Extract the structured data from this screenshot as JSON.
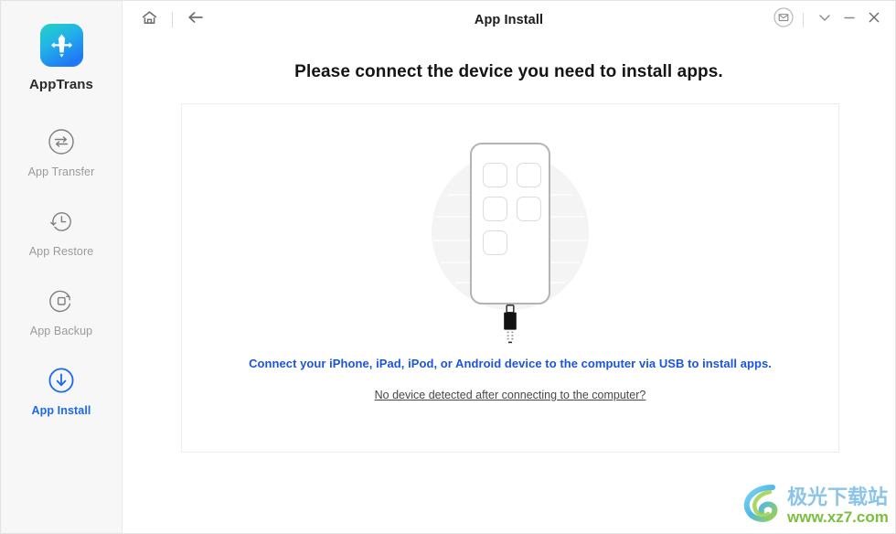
{
  "window": {
    "title": "App Install",
    "titlebar_left_buttons": [
      {
        "name": "home-icon",
        "label": "Home"
      },
      {
        "name": "back-arrow-icon",
        "label": "Back"
      }
    ],
    "titlebar_right_buttons": [
      {
        "name": "mail-icon",
        "label": "Feedback"
      },
      {
        "name": "chevron-down-icon",
        "label": "More"
      },
      {
        "name": "minimize-icon",
        "label": "Minimize"
      },
      {
        "name": "close-icon",
        "label": "Close"
      }
    ]
  },
  "sidebar": {
    "brand": {
      "name": "AppTrans",
      "logo_icon": "apptrans-logo-icon",
      "gradient_from": "#1ecfc4",
      "gradient_to": "#1f7ff5"
    },
    "items": [
      {
        "label": "App Transfer",
        "icon": "transfer-arrows-icon",
        "active": false
      },
      {
        "label": "App Restore",
        "icon": "clock-restore-icon",
        "active": false
      },
      {
        "label": "App Backup",
        "icon": "square-refresh-icon",
        "active": false
      },
      {
        "label": "App Install",
        "icon": "download-arrow-icon",
        "active": true
      }
    ],
    "active_color": "#1a68f0",
    "inactive_color": "#9a9a9a",
    "background": "#f7f7f7"
  },
  "main": {
    "heading": "Please connect the device you need to install apps.",
    "illustration": {
      "device_icon": "phone-with-usb-cable-icon",
      "app_tile_count": 5
    },
    "instruction": "Connect your iPhone, iPad, iPod, or Android device to the computer via USB to install apps.",
    "instruction_color": "#1b54e0",
    "help_link": "No device detected after connecting to the computer?"
  },
  "watermark": {
    "title": "极光下载站",
    "url": "www.xz7.com",
    "logo_icon": "aurora-spiral-icon"
  }
}
